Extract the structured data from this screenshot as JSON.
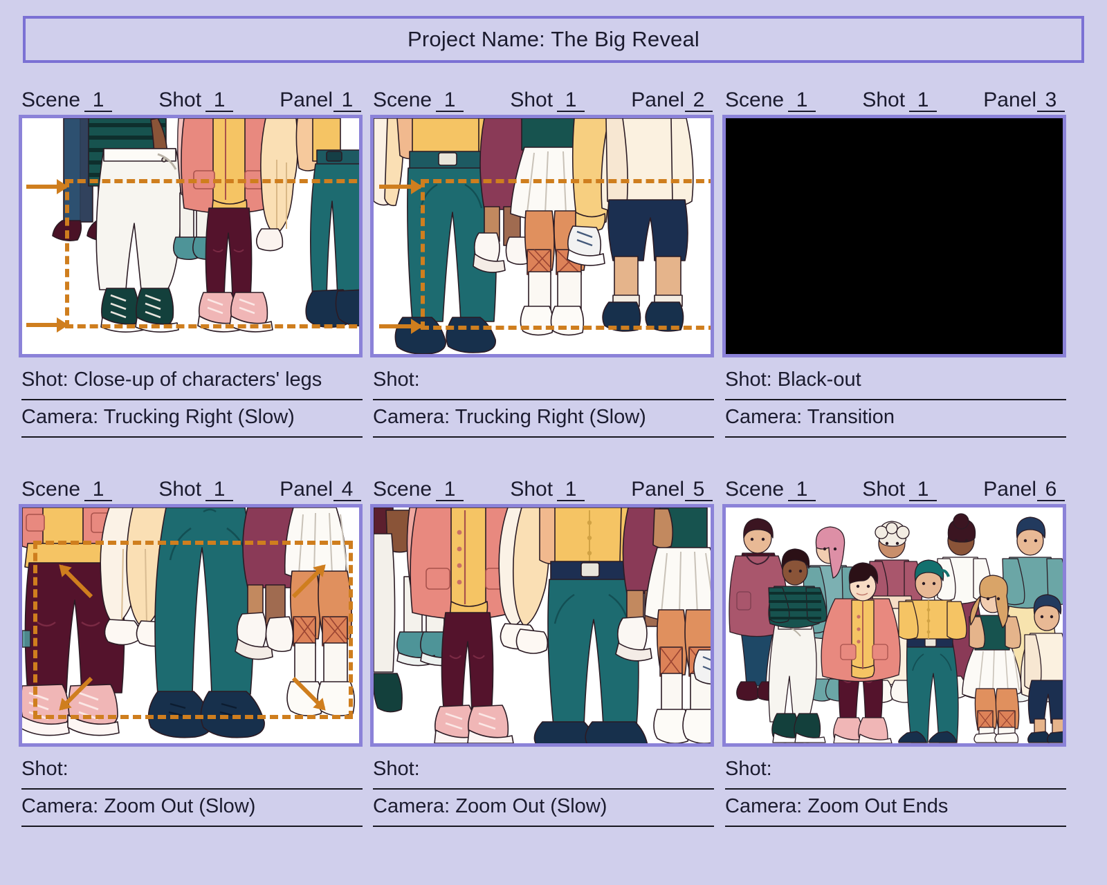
{
  "document": {
    "type": "storyboard",
    "title_label": "Project Name:",
    "project_name": "The Big Reveal",
    "title_full": "Project Name: The Big Reveal"
  },
  "theme": {
    "page_background": "#d0cfec",
    "frame_border": "#8b82d8",
    "title_border": "#7b71d4",
    "text": "#1b1b2e",
    "rule": "#16161f",
    "camera_marker": "#cf7e1e",
    "blackout": "#000000"
  },
  "field_labels": {
    "scene": "Scene",
    "shot": "Shot",
    "panel": "Panel",
    "shot_caption": "Shot:",
    "camera_caption": "Camera:"
  },
  "panels": [
    {
      "scene": "1",
      "shot": "1",
      "panel": "1",
      "shot_text": "Shot: Close-up of characters' legs",
      "camera_text": "Camera: Trucking Right (Slow)",
      "art": "legs-group-a",
      "overlay": "trucking-right"
    },
    {
      "scene": "1",
      "shot": "1",
      "panel": "2",
      "shot_text": "Shot:",
      "camera_text": "Camera: Trucking Right (Slow)",
      "art": "legs-group-b",
      "overlay": "trucking-right"
    },
    {
      "scene": "1",
      "shot": "1",
      "panel": "3",
      "shot_text": "Shot: Black-out",
      "camera_text": "Camera: Transition",
      "art": "blackout",
      "overlay": "none"
    },
    {
      "scene": "1",
      "shot": "1",
      "panel": "4",
      "shot_text": "Shot:",
      "camera_text": "Camera: Zoom Out (Slow)",
      "art": "legs-group-c",
      "overlay": "zoom-out"
    },
    {
      "scene": "1",
      "shot": "1",
      "panel": "5",
      "shot_text": "Shot:",
      "camera_text": "Camera: Zoom Out (Slow)",
      "art": "legs-group-d",
      "overlay": "none"
    },
    {
      "scene": "1",
      "shot": "1",
      "panel": "6",
      "shot_text": "Shot:",
      "camera_text": "Camera: Zoom Out Ends",
      "art": "full-group-ten-characters",
      "overlay": "none"
    }
  ]
}
